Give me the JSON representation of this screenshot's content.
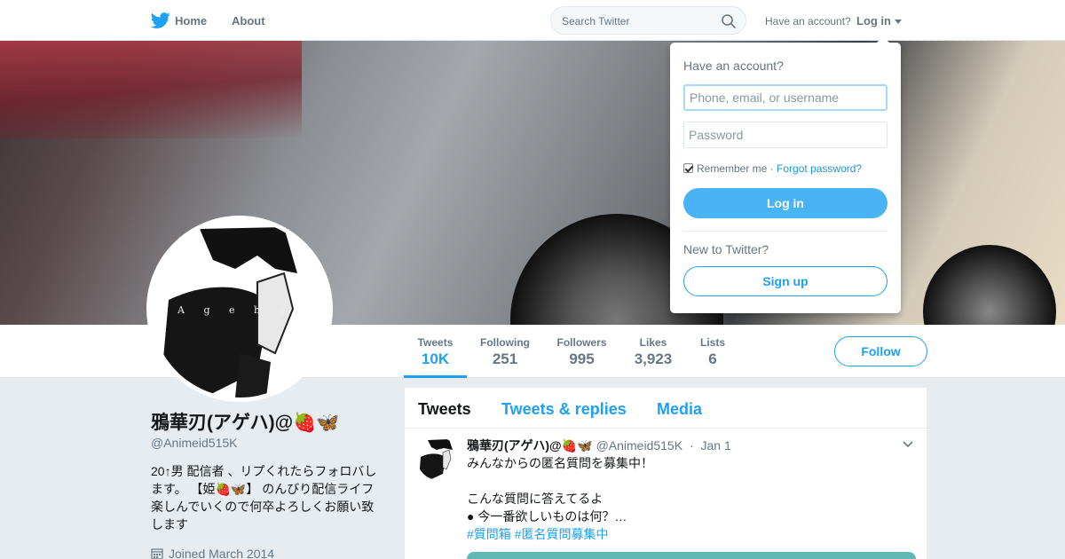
{
  "nav": {
    "home": "Home",
    "about": "About",
    "search_placeholder": "Search Twitter",
    "have_account": "Have an account?",
    "login": "Log in"
  },
  "login_dropdown": {
    "heading": "Have an account?",
    "username_placeholder": "Phone, email, or username",
    "password_placeholder": "Password",
    "remember_me": "Remember me",
    "separator": "·",
    "forgot_password": "Forgot password?",
    "login_button": "Log in",
    "new_to_twitter": "New to Twitter?",
    "signup_button": "Sign up"
  },
  "profile": {
    "name": "鴉華刃(アゲハ)@🍓🦋",
    "handle": "@Animeid515K",
    "bio": "20↑男 配信者 、リプくれたらフォロバします。 【姫🍓🦋】 のんびり配信ライフ楽しんでいくので何卒よろしくお願い致します",
    "joined": "Joined March 2014",
    "avatar_text": "A g e h a"
  },
  "stats": [
    {
      "label": "Tweets",
      "value": "10K"
    },
    {
      "label": "Following",
      "value": "251"
    },
    {
      "label": "Followers",
      "value": "995"
    },
    {
      "label": "Likes",
      "value": "3,923"
    },
    {
      "label": "Lists",
      "value": "6"
    }
  ],
  "follow_button": "Follow",
  "timeline": {
    "tabs": [
      "Tweets",
      "Tweets & replies",
      "Media"
    ],
    "tweet": {
      "name": "鴉華刃(アゲハ)@🍓🦋",
      "handle": "@Animeid515K",
      "separator": "·",
      "date": "Jan 1",
      "line1": "みんなからの匿名質問を募集中！",
      "line2": "こんな質問に答えてるよ",
      "line3": "● 今一番欲しいものは何？…",
      "hashtag1": "#質問箱",
      "hashtag2": "#匿名質問募集中"
    }
  },
  "colors": {
    "accent": "#1da1f2",
    "login_button": "#4ab3f4",
    "page_bg": "#e6ecf0"
  }
}
